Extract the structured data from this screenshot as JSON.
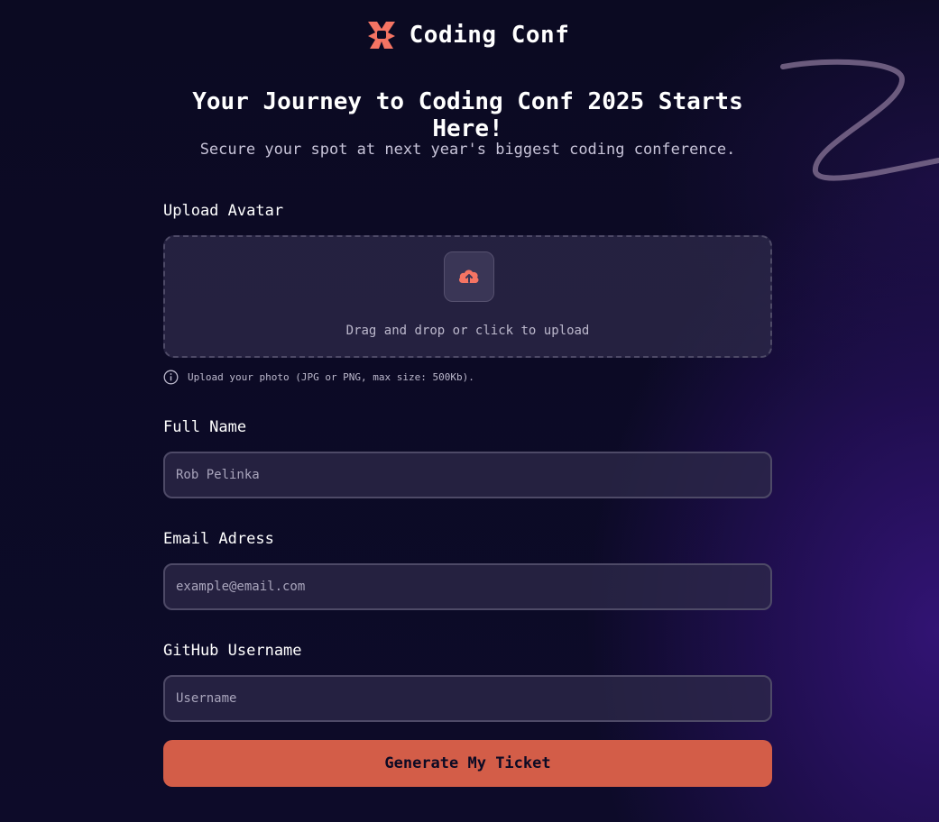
{
  "brand": {
    "name": "Coding Conf"
  },
  "hero": {
    "title": "Your Journey to Coding Conf 2025 Starts Here!",
    "subtitle": "Secure your spot at next year's biggest coding conference."
  },
  "avatar": {
    "label": "Upload Avatar",
    "drop_text": "Drag and drop or click to upload",
    "hint": "Upload your photo (JPG or PNG, max size: 500Kb)."
  },
  "full_name": {
    "label": "Full Name",
    "value": "",
    "placeholder": "Rob Pelinka"
  },
  "email": {
    "label": "Email Adress",
    "value": "",
    "placeholder": "example@email.com"
  },
  "github": {
    "label": "GitHub Username",
    "value": "",
    "placeholder": "Username"
  },
  "submit": {
    "label": "Generate My Ticket"
  },
  "icons": {
    "logo": "coding-conf-logo-icon",
    "upload": "cloud-upload-icon",
    "info": "info-circle-icon"
  },
  "colors": {
    "accent": "#d35d48",
    "background": "#0c0a24",
    "input_bg": "#2e2a4a",
    "border": "#4e4a67"
  }
}
